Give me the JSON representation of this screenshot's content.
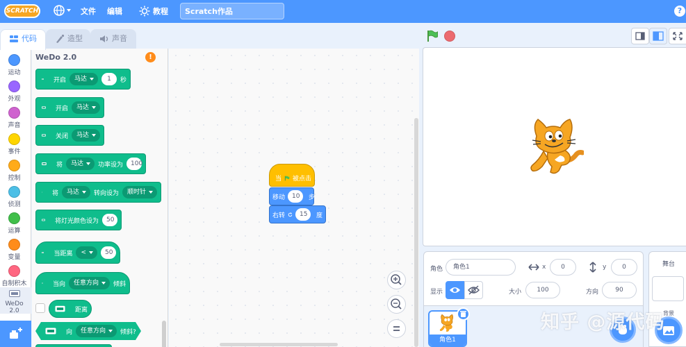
{
  "menubar": {
    "logo": "SCRATCH",
    "file": "文件",
    "edit": "编辑",
    "tutorials": "教程",
    "project_title": "Scratch作品"
  },
  "tabs": {
    "code": "代码",
    "costumes": "造型",
    "sounds": "声音"
  },
  "categories": [
    {
      "label": "运动",
      "color": "#4c97ff"
    },
    {
      "label": "外观",
      "color": "#9966ff"
    },
    {
      "label": "声音",
      "color": "#cf63cf"
    },
    {
      "label": "事件",
      "color": "#ffd500"
    },
    {
      "label": "控制",
      "color": "#ffab19"
    },
    {
      "label": "侦测",
      "color": "#4cbfe6"
    },
    {
      "label": "运算",
      "color": "#40bf4a"
    },
    {
      "label": "变量",
      "color": "#ff8c1a"
    },
    {
      "label": "自制积木",
      "color": "#ff6680"
    },
    {
      "label": "WeDo 2.0",
      "color": "#0fbd8c"
    }
  ],
  "palette": {
    "title": "WeDo 2.0",
    "blocks": [
      {
        "t1": "开启",
        "dd": "马达",
        "num": "1",
        "t2": "秒"
      },
      {
        "t1": "开启",
        "dd": "马达"
      },
      {
        "t1": "关闭",
        "dd": "马达"
      },
      {
        "t1": "将",
        "dd": "马达",
        "t2": "功率设为",
        "num": "100"
      },
      {
        "t1": "将",
        "dd": "马达",
        "t2": "转向设为",
        "dd2": "顺时针"
      },
      {
        "t1": "将灯光颜色设为",
        "num": "50"
      },
      {
        "t1": "当距离",
        "dd": "<",
        "num": "50"
      },
      {
        "t1": "当向",
        "dd": "任意方向",
        "t2": "倾斜"
      },
      {
        "t1": "距离"
      },
      {
        "t1": "向",
        "dd": "任意方向",
        "t2": "倾斜?"
      }
    ]
  },
  "script": {
    "hat_when": "当",
    "hat_clicked": "被点击",
    "move": "移动",
    "move_steps": "10",
    "move_unit": "步",
    "turn": "右转",
    "turn_deg": "15",
    "turn_unit": "度"
  },
  "sprite_info": {
    "sprite_label": "角色",
    "sprite_name": "角色1",
    "x_label": "x",
    "x_value": "0",
    "y_label": "y",
    "y_value": "0",
    "show_label": "显示",
    "size_label": "大小",
    "size_value": "100",
    "direction_label": "方向",
    "direction_value": "90",
    "thumb_label": "角色1"
  },
  "stage_pane": {
    "title": "舞台",
    "backdrop_label": "背景"
  },
  "watermark": "知乎 @源代码",
  "icons": [
    "globe-icon",
    "tutorial-icon",
    "help-icon",
    "code-icon",
    "costume-icon",
    "sound-icon",
    "green-flag-icon",
    "stop-icon",
    "zoom-in-icon",
    "zoom-out-icon",
    "zoom-reset-icon",
    "eye-icon",
    "eye-off-icon",
    "trash-icon",
    "add-extension-icon"
  ]
}
